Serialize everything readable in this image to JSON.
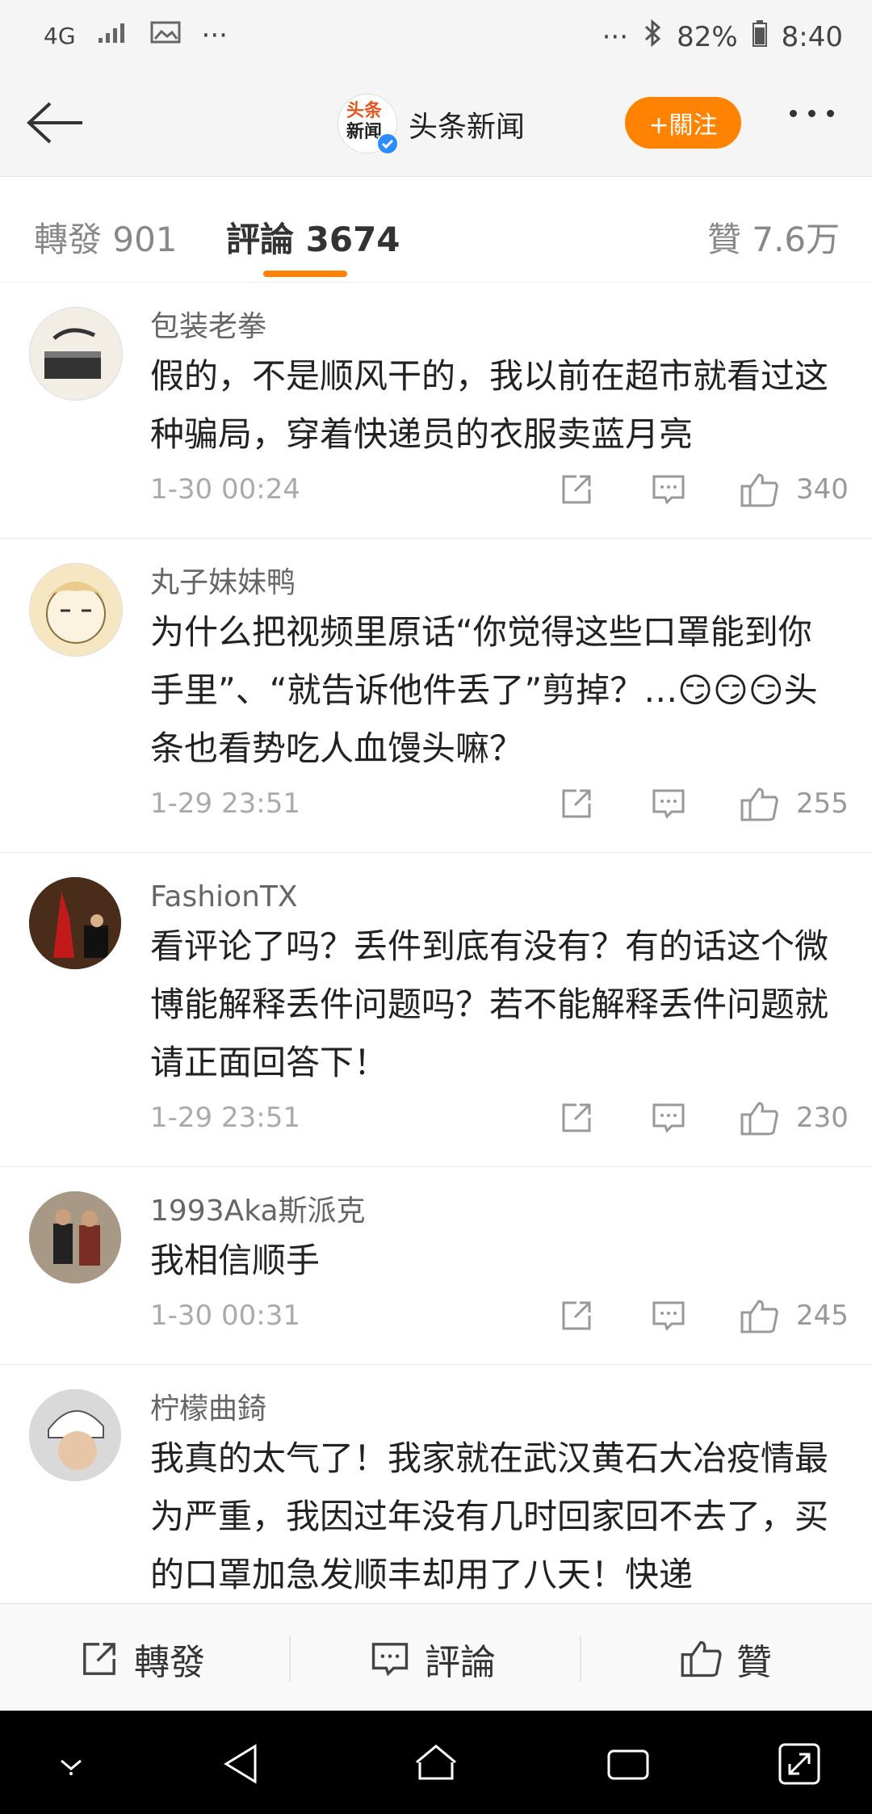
{
  "status_bar": {
    "network": "4G",
    "battery": "82%",
    "time": "8:40",
    "dots": "···"
  },
  "header": {
    "title": "头条新闻",
    "follow_label": "+關注",
    "logo_line1": "头条",
    "logo_line2": "新闻"
  },
  "tabs": [
    {
      "label": "轉發 901"
    },
    {
      "label": "評論 3674"
    },
    {
      "label": "贊 7.6万"
    }
  ],
  "comments": [
    {
      "author": "包装老拳",
      "text": "假的，不是顺风干的，我以前在超市就看过这种骗局，穿着快递员的衣服卖蓝月亮",
      "time": "1-30 00:24",
      "likes": "340"
    },
    {
      "author": "丸子妹妹鸭",
      "text": "为什么把视频里原话“你觉得这些口罩能到你手里”、“就告诉他件丢了”剪掉？…😏😏😏头条也看势吃人血馒头嘛？",
      "time": "1-29 23:51",
      "likes": "255"
    },
    {
      "author": "FashionTX",
      "text": "看评论了吗？丢件到底有没有？有的话这个微博能解释丢件问题吗？若不能解释丢件问题就请正面回答下！",
      "time": "1-29 23:51",
      "likes": "230"
    },
    {
      "author": "1993Aka斯派克",
      "text": "我相信顺手",
      "time": "1-30 00:31",
      "likes": "245"
    },
    {
      "author": "柠檬曲錡",
      "text": "我真的太气了！我家就在武汉黄石大冶疫情最为严重，我因过年没有几时回家回不去了，买的口罩加急发顺丰却用了八天！快递",
      "time": "",
      "likes": ""
    }
  ],
  "bottom_bar": {
    "repost": "轉發",
    "comment": "評論",
    "like": "贊"
  },
  "colors": {
    "accent": "#ff8200",
    "verified": "#2a8cff"
  }
}
